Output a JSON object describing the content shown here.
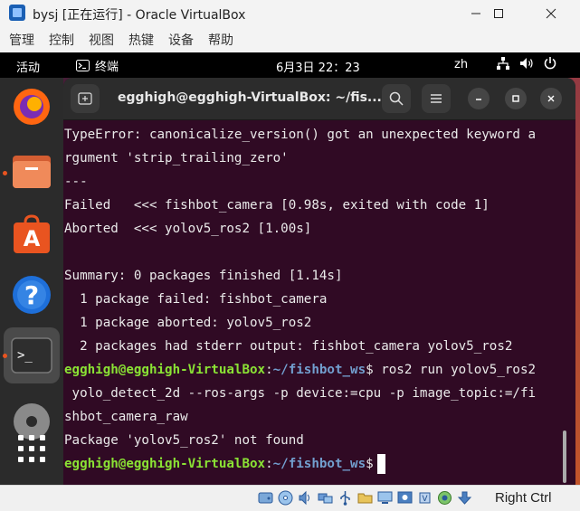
{
  "host_window": {
    "title": "bysj [正在运行] - Oracle VirtualBox",
    "controls": [
      "minimize",
      "maximize",
      "close"
    ]
  },
  "vbox_menu": {
    "items": [
      "管理",
      "控制",
      "视图",
      "热键",
      "设备",
      "帮助"
    ]
  },
  "gnome_topbar": {
    "activities": "活动",
    "app_menu": "终端",
    "clock": "6月3日  22：23",
    "input_method": "zh"
  },
  "dock": {
    "apps": [
      "firefox-icon",
      "files-icon",
      "app-center-icon",
      "help-icon",
      "terminal-icon",
      "disc-icon",
      "show-apps-icon"
    ]
  },
  "terminal": {
    "title": "egghigh@egghigh-VirtualBox: ~/fis...",
    "lines": [
      {
        "text": "TypeError: canonicalize_version() got an unexpected keyword a"
      },
      {
        "text": "rgument 'strip_trailing_zero'"
      },
      {
        "text": "---"
      },
      {
        "text": "Failed   <<< fishbot_camera [0.98s, exited with code 1]"
      },
      {
        "text": "Aborted  <<< yolov5_ros2 [1.00s]"
      },
      {
        "text": ""
      },
      {
        "text": "Summary: 0 packages finished [1.14s]"
      },
      {
        "text": "  1 package failed: fishbot_camera"
      },
      {
        "text": "  1 package aborted: yolov5_ros2"
      },
      {
        "text": "  2 packages had stderr output: fishbot_camera yolov5_ros2"
      },
      {
        "user": "egghigh@egghigh-VirtualBox",
        "sep": ":",
        "path": "~/fishbot_ws",
        "text": "$ ros2 run yolov5_ros2"
      },
      {
        "text": " yolo_detect_2d --ros-args -p device:=cpu -p image_topic:=/fi"
      },
      {
        "text": "shbot_camera_raw"
      },
      {
        "text": "Package 'yolov5_ros2' not found"
      },
      {
        "user": "egghigh@egghigh-VirtualBox",
        "sep": ":",
        "path": "~/fishbot_ws",
        "text": "$"
      }
    ]
  },
  "vbox_status": {
    "host_key": "Right Ctrl",
    "icons": [
      "hard-disk-icon",
      "optical-drive-icon",
      "audio-icon",
      "network-icon",
      "usb-icon",
      "shared-folders-icon",
      "display-icon",
      "video-capture-icon",
      "cpu-icon",
      "virtualization-icon",
      "mouse-integration-icon",
      "keyboard-icon"
    ]
  }
}
